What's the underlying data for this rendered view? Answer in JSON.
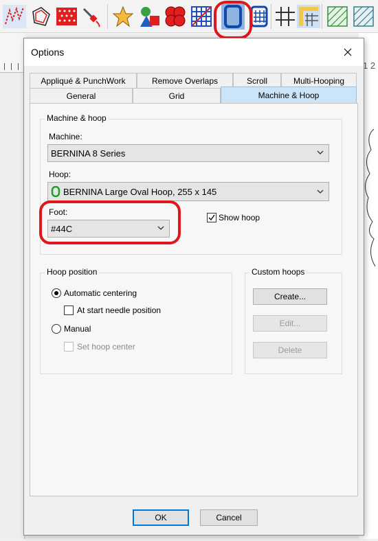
{
  "colors": {
    "highlight": "#e0161d",
    "active_tab": "#cce4f7",
    "default_button_border": "#0078d7",
    "hoop_icon": "#1f9d2c"
  },
  "toolbar": {
    "icons": [
      "stitch-pattern-icon",
      "outline-shape-icon",
      "fill-pattern-icon",
      "needle-icon",
      "appliqué-shapes-icon",
      "shapes-icon",
      "flower-icon",
      "grid-fill-icon",
      "hoop-icon",
      "hoop-grid-icon",
      "grid-icon",
      "ruler-grid-icon",
      "hatch-fill-icon",
      "hatch-fill-alt-icon"
    ],
    "highlighted": "hoop-icon"
  },
  "ruler": {
    "right_text": "1 2"
  },
  "dialog": {
    "title": "Options",
    "tabs_row1": [
      "Appliqué & PunchWork",
      "Remove Overlaps",
      "Scroll",
      "Multi-Hooping"
    ],
    "tabs_row2": [
      "General",
      "Grid",
      "Machine & Hoop"
    ],
    "active_tab": "Machine & Hoop",
    "machine_hoop_group": {
      "legend": "Machine & hoop",
      "machine_label": "Machine:",
      "machine_value": "BERNINA 8 Series",
      "hoop_label": "Hoop:",
      "hoop_value": "BERNINA Large Oval Hoop, 255 x 145",
      "foot_label": "Foot:",
      "foot_value": "#44C",
      "show_hoop_label": "Show hoop",
      "show_hoop_checked": true
    },
    "hoop_position_group": {
      "legend": "Hoop position",
      "automatic_label": "Automatic centering",
      "at_start_label": "At start needle position",
      "manual_label": "Manual",
      "set_center_label": "Set hoop center",
      "selected": "Automatic centering"
    },
    "custom_hoops_group": {
      "legend": "Custom hoops",
      "create_label": "Create...",
      "edit_label": "Edit...",
      "delete_label": "Delete"
    },
    "ok_label": "OK",
    "cancel_label": "Cancel"
  }
}
